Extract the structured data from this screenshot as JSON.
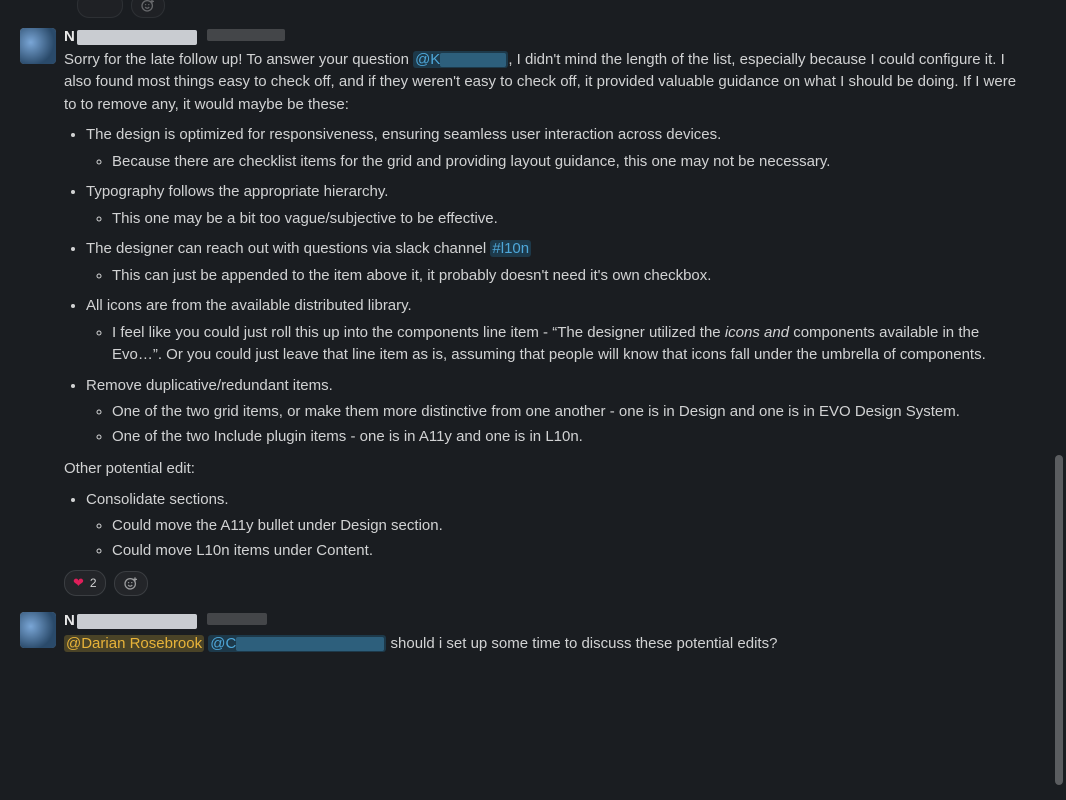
{
  "reactions_top": {
    "add_title": "Add reaction"
  },
  "message1": {
    "author_initial": "N",
    "body": {
      "intro_before_mention": "Sorry for the late follow up! To answer your question ",
      "mention_prefix": "@K",
      "intro_after_mention": ", I didn't mind the length of the list, especially because I could configure it. I also found most things easy to check off, and if they weren't easy to check off, it provided valuable guidance on what I should be doing. If I were to to remove any, it would maybe be these:"
    },
    "bullets": [
      {
        "text": "The design is optimized for responsiveness, ensuring seamless user interaction across devices.",
        "sub": [
          "Because there are checklist items for the grid and providing layout guidance, this one may not be necessary."
        ]
      },
      {
        "text": "Typography follows the appropriate hierarchy.",
        "sub": [
          "This one may be a bit too vague/subjective to be effective."
        ]
      },
      {
        "text_before_link": "The designer can reach out with questions via slack channel ",
        "link": "#l10n",
        "sub": [
          "This can just be appended to the item above it, it probably doesn't need it's own checkbox."
        ]
      },
      {
        "text": "All icons are from the available distributed library.",
        "sub_rich": {
          "before_em": "I feel like you could just roll this up into the components line item - “The designer utilized the ",
          "em": "icons and",
          "after_em": " components available in the Evo…”. Or you could just leave that line item as is, assuming that people will know that icons fall under the umbrella of components."
        }
      },
      {
        "text": "Remove duplicative/redundant items.",
        "sub": [
          "One of the two grid items, or make them more distinctive from one another - one is in Design and one is in EVO Design System.",
          "One of the two Include plugin items - one is in A11y and one is in L10n."
        ]
      }
    ],
    "other_edit_label": "Other potential edit:",
    "other_bullets": [
      {
        "text": "Consolidate sections.",
        "sub": [
          "Could move the A11y bullet under Design section.",
          "Could move L10n items under Content."
        ]
      }
    ],
    "reactions": {
      "heart_count": "2",
      "add_title": "Add reaction"
    }
  },
  "message2": {
    "author_initial": "N",
    "mention_gold": "@Darian Rosebrook",
    "mention_blue_prefix": "@C",
    "tail": " should i set up some time to discuss these potential edits?"
  }
}
